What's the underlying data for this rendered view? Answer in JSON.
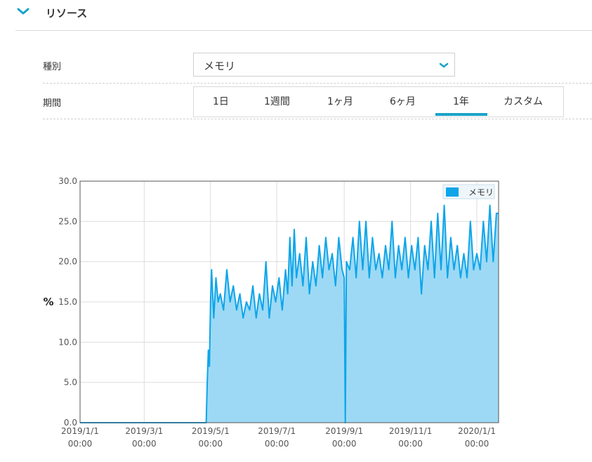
{
  "section": {
    "title": "リソース"
  },
  "filters": {
    "type_label": "種別",
    "type_value": "メモリ",
    "period_label": "期間",
    "period_tabs": [
      "1日",
      "1週間",
      "1ヶ月",
      "6ヶ月",
      "1年",
      "カスタム"
    ],
    "selected_period": "1年"
  },
  "colors": {
    "accent": "#1aa3c9",
    "series_line": "#0ea5e9",
    "series_fill": "#9dd9f5"
  },
  "chart_data": {
    "type": "area",
    "title": "",
    "xlabel": "",
    "ylabel": "%",
    "ylim": [
      0,
      30
    ],
    "yticks": [
      "0.0",
      "5.0",
      "10.0",
      "15.0",
      "20.0",
      "25.0",
      "30.0"
    ],
    "x_range": [
      "2019-01-01",
      "2020-01-21"
    ],
    "xtick_dates": [
      "2019/1/1",
      "2019/3/1",
      "2019/5/1",
      "2019/7/1",
      "2019/9/1",
      "2019/11/1",
      "2020/1/1"
    ],
    "xtick_time": "00:00",
    "grid": true,
    "legend": {
      "position": "top-right",
      "entries": [
        "メモリ"
      ]
    },
    "series": [
      {
        "name": "メモリ",
        "points": [
          [
            "2019-01-01",
            0
          ],
          [
            "2019-04-27",
            0
          ],
          [
            "2019-04-28",
            5
          ],
          [
            "2019-04-29",
            9
          ],
          [
            "2019-04-30",
            7
          ],
          [
            "2019-05-01",
            15
          ],
          [
            "2019-05-02",
            19
          ],
          [
            "2019-05-04",
            13
          ],
          [
            "2019-05-06",
            18
          ],
          [
            "2019-05-08",
            15
          ],
          [
            "2019-05-10",
            16
          ],
          [
            "2019-05-13",
            14
          ],
          [
            "2019-05-16",
            19
          ],
          [
            "2019-05-19",
            15
          ],
          [
            "2019-05-22",
            17
          ],
          [
            "2019-05-25",
            14
          ],
          [
            "2019-05-28",
            16
          ],
          [
            "2019-05-31",
            13
          ],
          [
            "2019-06-03",
            15
          ],
          [
            "2019-06-06",
            14
          ],
          [
            "2019-06-09",
            17
          ],
          [
            "2019-06-12",
            13
          ],
          [
            "2019-06-15",
            16
          ],
          [
            "2019-06-18",
            14
          ],
          [
            "2019-06-21",
            20
          ],
          [
            "2019-06-24",
            13
          ],
          [
            "2019-06-27",
            17
          ],
          [
            "2019-06-30",
            15
          ],
          [
            "2019-07-03",
            18
          ],
          [
            "2019-07-06",
            14
          ],
          [
            "2019-07-09",
            19
          ],
          [
            "2019-07-11",
            16
          ],
          [
            "2019-07-13",
            23
          ],
          [
            "2019-07-15",
            17
          ],
          [
            "2019-07-17",
            24
          ],
          [
            "2019-07-19",
            18
          ],
          [
            "2019-07-22",
            21
          ],
          [
            "2019-07-25",
            17
          ],
          [
            "2019-07-28",
            23
          ],
          [
            "2019-07-31",
            16
          ],
          [
            "2019-08-03",
            20
          ],
          [
            "2019-08-06",
            17
          ],
          [
            "2019-08-09",
            22
          ],
          [
            "2019-08-12",
            18
          ],
          [
            "2019-08-15",
            23
          ],
          [
            "2019-08-18",
            19
          ],
          [
            "2019-08-21",
            21
          ],
          [
            "2019-08-24",
            17
          ],
          [
            "2019-08-27",
            23
          ],
          [
            "2019-08-30",
            19
          ],
          [
            "2019-09-01",
            18
          ],
          [
            "2019-09-02",
            0
          ],
          [
            "2019-09-03",
            20
          ],
          [
            "2019-09-06",
            19
          ],
          [
            "2019-09-09",
            23
          ],
          [
            "2019-09-12",
            18
          ],
          [
            "2019-09-15",
            25
          ],
          [
            "2019-09-18",
            19
          ],
          [
            "2019-09-21",
            25
          ],
          [
            "2019-09-24",
            18
          ],
          [
            "2019-09-27",
            23
          ],
          [
            "2019-09-30",
            19
          ],
          [
            "2019-10-03",
            21
          ],
          [
            "2019-10-06",
            18
          ],
          [
            "2019-10-09",
            22
          ],
          [
            "2019-10-12",
            19
          ],
          [
            "2019-10-15",
            25
          ],
          [
            "2019-10-18",
            18
          ],
          [
            "2019-10-21",
            22
          ],
          [
            "2019-10-24",
            19
          ],
          [
            "2019-10-27",
            23
          ],
          [
            "2019-10-30",
            18
          ],
          [
            "2019-11-02",
            22
          ],
          [
            "2019-11-05",
            19
          ],
          [
            "2019-11-08",
            23
          ],
          [
            "2019-11-11",
            16
          ],
          [
            "2019-11-14",
            22
          ],
          [
            "2019-11-17",
            19
          ],
          [
            "2019-11-20",
            25
          ],
          [
            "2019-11-23",
            18
          ],
          [
            "2019-11-26",
            26
          ],
          [
            "2019-11-29",
            19
          ],
          [
            "2019-12-02",
            27
          ],
          [
            "2019-12-05",
            18
          ],
          [
            "2019-12-08",
            23
          ],
          [
            "2019-12-11",
            19
          ],
          [
            "2019-12-14",
            22
          ],
          [
            "2019-12-17",
            18
          ],
          [
            "2019-12-20",
            21
          ],
          [
            "2019-12-23",
            18
          ],
          [
            "2019-12-26",
            25
          ],
          [
            "2019-12-29",
            19
          ],
          [
            "2020-01-01",
            21
          ],
          [
            "2020-01-04",
            19
          ],
          [
            "2020-01-07",
            25
          ],
          [
            "2020-01-10",
            20
          ],
          [
            "2020-01-13",
            27
          ],
          [
            "2020-01-16",
            20
          ],
          [
            "2020-01-19",
            26
          ],
          [
            "2020-01-21",
            26
          ]
        ]
      }
    ]
  }
}
